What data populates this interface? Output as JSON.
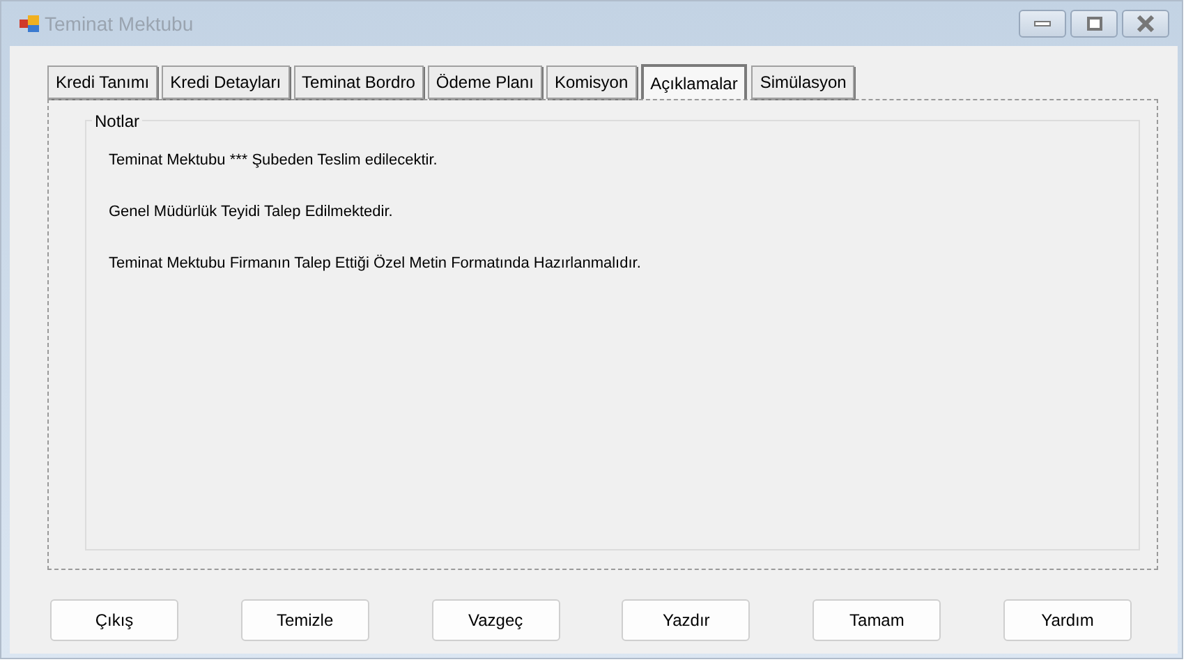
{
  "window": {
    "title": "Teminat Mektubu"
  },
  "tabs": [
    {
      "label": "Kredi Tanımı",
      "selected": false
    },
    {
      "label": "Kredi Detayları",
      "selected": false
    },
    {
      "label": "Teminat Bordro",
      "selected": false
    },
    {
      "label": "Ödeme Planı",
      "selected": false
    },
    {
      "label": "Komisyon",
      "selected": false
    },
    {
      "label": "Açıklamalar",
      "selected": true
    },
    {
      "label": "Simülasyon",
      "selected": false
    }
  ],
  "notes": {
    "title": "Notlar",
    "lines": [
      "Teminat Mektubu *** Şubeden Teslim edilecektir.",
      "Genel Müdürlük Teyidi Talep Edilmektedir.",
      "Teminat Mektubu Firmanın Talep Ettiği Özel Metin Formatında Hazırlanmalıdır."
    ]
  },
  "buttons": [
    "Çıkış",
    "Temizle",
    "Vazgeç",
    "Yazdır",
    "Tamam",
    "Yardım"
  ]
}
